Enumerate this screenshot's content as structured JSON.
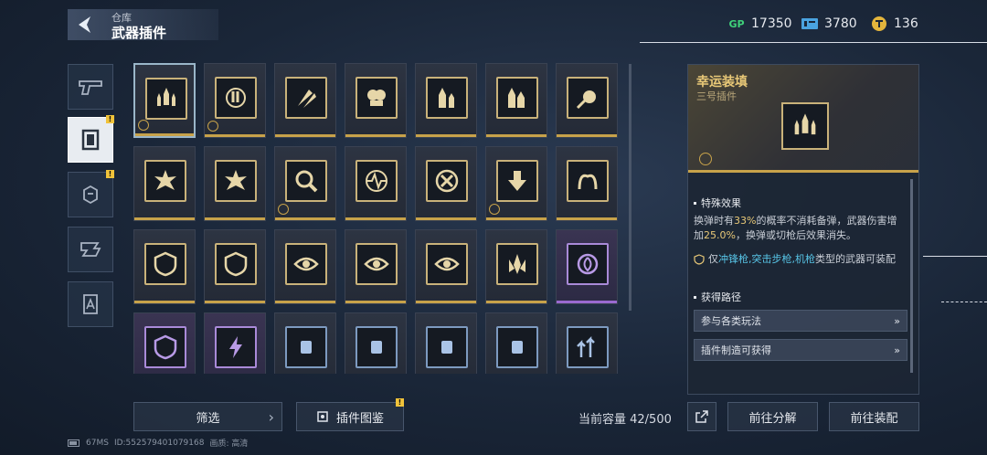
{
  "header": {
    "subtitle": "仓库",
    "title": "武器插件"
  },
  "currencies": [
    {
      "icon": "gp-icon",
      "label": "GP",
      "value": "17350",
      "color": "#3fd07a"
    },
    {
      "icon": "ticket-icon",
      "value": "3780",
      "color": "#4aa3e0"
    },
    {
      "icon": "coin-icon",
      "value": "136",
      "color": "#e3b53c"
    }
  ],
  "nav": {
    "items": [
      {
        "name": "nav-weapon",
        "icon": "pistol-icon"
      },
      {
        "name": "nav-plugin",
        "icon": "plugin-icon",
        "active": true,
        "badge": "!"
      },
      {
        "name": "nav-item3",
        "icon": "box-icon",
        "badge": "!"
      },
      {
        "name": "nav-item4",
        "icon": "puzzle-icon"
      },
      {
        "name": "nav-item5",
        "icon": "document-icon"
      }
    ]
  },
  "grid": {
    "rows": [
      [
        "rarity-gold",
        "rarity-gold",
        "rarity-gold",
        "rarity-gold",
        "rarity-gold",
        "rarity-gold",
        "rarity-gold"
      ],
      [
        "rarity-gold",
        "rarity-gold",
        "rarity-gold",
        "rarity-gold",
        "rarity-gold",
        "rarity-gold",
        "rarity-gold"
      ],
      [
        "rarity-gold",
        "rarity-gold",
        "rarity-gold",
        "rarity-gold",
        "rarity-gold",
        "rarity-gold",
        "rarity-purple"
      ],
      [
        "rarity-purple",
        "rarity-purple",
        "rarity-blue",
        "rarity-blue",
        "rarity-blue",
        "rarity-blue",
        "rarity-blue"
      ]
    ]
  },
  "bottom": {
    "filter_label": "筛选",
    "catalog_label": "插件图鉴",
    "catalog_badge": "!",
    "capacity": "当前容量 42/500",
    "decompose_label": "前往分解",
    "equip_label": "前往装配"
  },
  "footer": {
    "ping": "67MS",
    "id": "ID:552579401079168",
    "quality": "画质: 高清"
  },
  "detail": {
    "title": "幸运装填",
    "subtitle": "三号插件",
    "effect_head": "特殊效果",
    "desc_p1": "换弹时有",
    "desc_h1": "33%",
    "desc_p2": "的概率不消耗备弹，武器伤害增加",
    "desc_h2": "25.0%",
    "desc_p3": "，换弹或切枪后效果消失。",
    "restrict_p1": "仅",
    "restrict_weapons": "冲锋枪,突击步枪,机枪",
    "restrict_p2": "类型的武器可装配",
    "route_head": "获得路径",
    "routes": [
      "参与各类玩法",
      "插件制造可获得"
    ]
  }
}
